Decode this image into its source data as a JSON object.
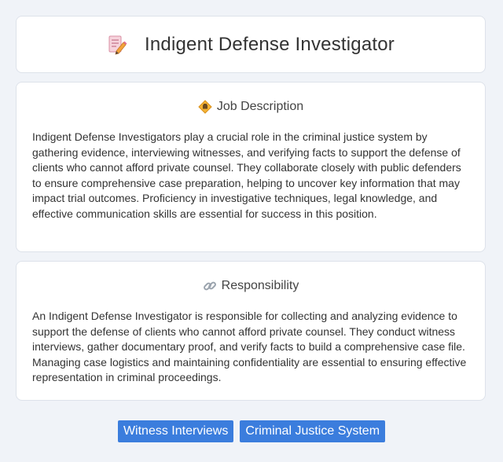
{
  "header": {
    "title": "Indigent Defense Investigator",
    "icon": "document-pencil-icon"
  },
  "sections": [
    {
      "heading": "Job Description",
      "icon": "diamond-badge-icon",
      "body": "Indigent Defense Investigators play a crucial role in the criminal justice system by gathering evidence, interviewing witnesses, and verifying facts to support the defense of clients who cannot afford private counsel. They collaborate closely with public defenders to ensure comprehensive case preparation, helping to uncover key information that may impact trial outcomes. Proficiency in investigative techniques, legal knowledge, and effective communication skills are essential for success in this position."
    },
    {
      "heading": "Responsibility",
      "icon": "link-icon",
      "body": "An Indigent Defense Investigator is responsible for collecting and analyzing evidence to support the defense of clients who cannot afford private counsel. They conduct witness interviews, gather documentary proof, and verify facts to build a comprehensive case file. Managing case logistics and maintaining confidentiality are essential to ensuring effective representation in criminal proceedings."
    }
  ],
  "tags": [
    "Witness Interviews",
    "Criminal Justice System"
  ],
  "colors": {
    "background": "#f0f3f8",
    "card": "#ffffff",
    "tag": "#3b7ddd",
    "tag_text": "#ffffff"
  }
}
